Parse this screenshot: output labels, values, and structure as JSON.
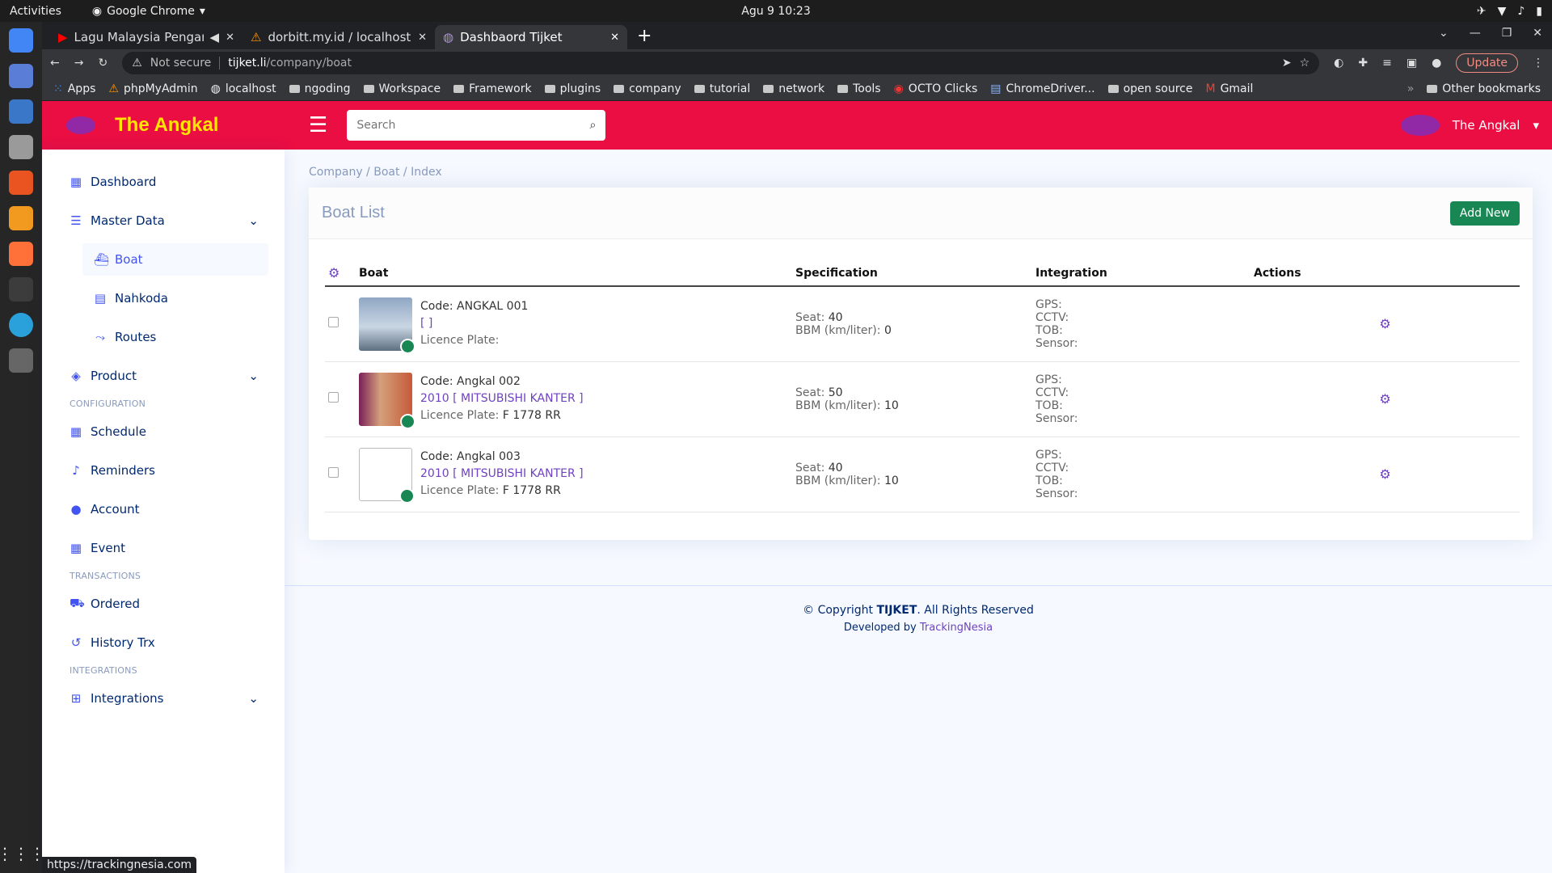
{
  "os": {
    "activities": "Activities",
    "app_name": "Google Chrome",
    "clock": "Agu 9  10:23"
  },
  "browser": {
    "tabs": [
      {
        "title": "Lagu Malaysia Pengan"
      },
      {
        "title": "dorbitt.my.id / localhost /"
      },
      {
        "title": "Dashbaord Tijket"
      }
    ],
    "not_secure": "Not secure",
    "url_host": "tijket.li",
    "url_path": "/company/boat",
    "update_label": "Update",
    "bookmarks": [
      "Apps",
      "phpMyAdmin",
      "localhost",
      "ngoding",
      "Workspace",
      "Framework",
      "plugins",
      "company",
      "tutorial",
      "network",
      "Tools",
      "OCTO Clicks",
      "ChromeDriver...",
      "open source",
      "Gmail"
    ],
    "other_bookmarks": "Other bookmarks",
    "status_url": "https://trackingnesia.com"
  },
  "header": {
    "brand": "The Angkal",
    "search_placeholder": "Search",
    "user": "The Angkal"
  },
  "sidebar": {
    "dashboard": "Dashboard",
    "master_data": "Master Data",
    "sub": [
      "Boat",
      "Nahkoda",
      "Routes"
    ],
    "product": "Product",
    "sec_config": "CONFIGURATION",
    "schedule": "Schedule",
    "reminders": "Reminders",
    "account": "Account",
    "event": "Event",
    "sec_trans": "TRANSACTIONS",
    "ordered": "Ordered",
    "history": "History Trx",
    "sec_integ": "INTEGRATIONS",
    "integrations": "Integrations"
  },
  "breadcrumb": [
    "Company",
    "Boat",
    "Index"
  ],
  "card": {
    "title": "Boat List",
    "add_new": "Add New"
  },
  "table": {
    "headers": {
      "boat": "Boat",
      "spec": "Specification",
      "integ": "Integration",
      "actions": "Actions"
    },
    "rows": [
      {
        "code_label": "Code:",
        "code": "ANGKAL 001",
        "model": "[ ]",
        "plate_label": "Licence Plate:",
        "plate": "",
        "seat_label": "Seat:",
        "seat": "40",
        "bbm_label": "BBM (km/liter):",
        "bbm": "0"
      },
      {
        "code_label": "Code:",
        "code": "Angkal 002",
        "model": "2010 [ MITSUBISHI KANTER ]",
        "plate_label": "Licence Plate:",
        "plate": "F 1778 RR",
        "seat_label": "Seat:",
        "seat": "50",
        "bbm_label": "BBM (km/liter):",
        "bbm": "10"
      },
      {
        "code_label": "Code:",
        "code": "Angkal 003",
        "model": "2010 [ MITSUBISHI KANTER ]",
        "plate_label": "Licence Plate:",
        "plate": "F 1778 RR",
        "seat_label": "Seat:",
        "seat": "40",
        "bbm_label": "BBM (km/liter):",
        "bbm": "10"
      }
    ],
    "integ_labels": [
      "GPS:",
      "CCTV:",
      "TOB:",
      "Sensor:"
    ]
  },
  "footer": {
    "copyright": "© Copyright",
    "brand": "TIJKET",
    "rights": ". All Rights Reserved",
    "developed": "Developed by",
    "dev_link": "TrackingNesia"
  }
}
